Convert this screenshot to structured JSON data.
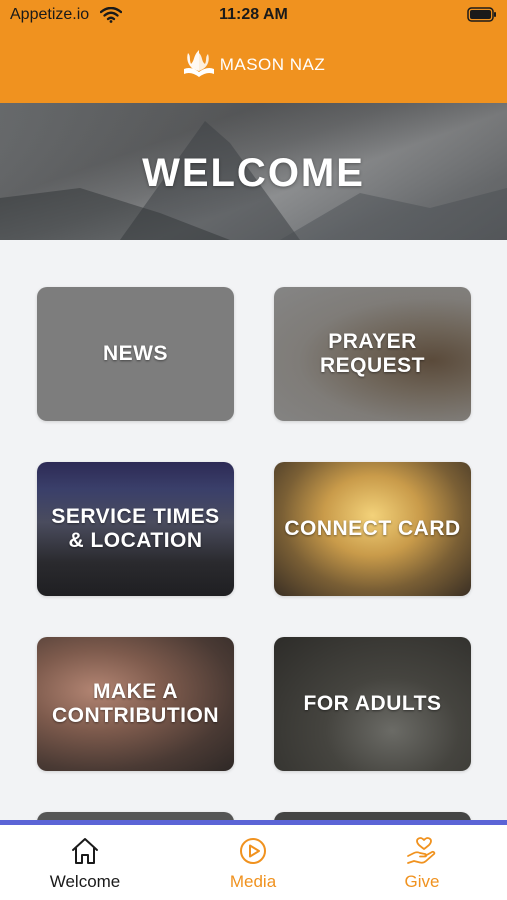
{
  "status_bar": {
    "carrier": "Appetize.io",
    "time": "11:28 AM"
  },
  "header": {
    "brand": "MASON NAZ",
    "background_color": "#f0921f",
    "logo_icon": "flame-book-logo-icon"
  },
  "hero": {
    "title": "WELCOME"
  },
  "cards": {
    "news": "NEWS",
    "prayer_request": "PRAYER REQUEST",
    "service_times": "SERVICE TIMES & LOCATION",
    "connect_card": "CONNECT CARD",
    "make_contribution": "MAKE A CONTRIBUTION",
    "for_adults": "FOR ADULTS"
  },
  "tab_bar": {
    "accent_color": "#5b64d6",
    "tabs": [
      {
        "label": "Welcome",
        "icon": "home-icon",
        "active": true
      },
      {
        "label": "Media",
        "icon": "play-circle-icon",
        "active": false
      },
      {
        "label": "Give",
        "icon": "heart-hand-icon",
        "active": false
      }
    ]
  }
}
